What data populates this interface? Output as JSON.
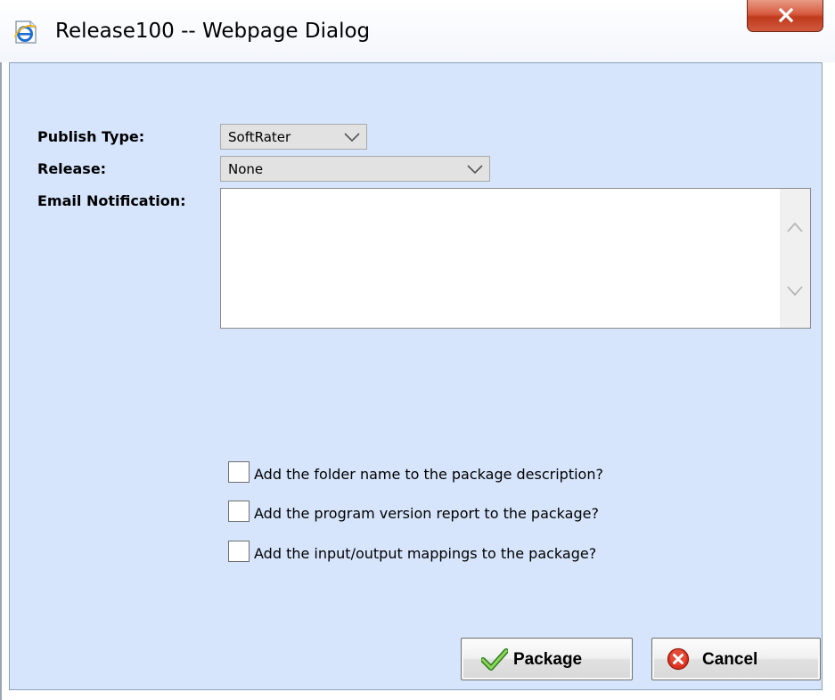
{
  "window": {
    "title": "Release100 -- Webpage Dialog",
    "close_icon": "close-x-icon",
    "app_icon": "internet-explorer-icon"
  },
  "form": {
    "publish_type": {
      "label": "Publish Type:",
      "value": "SoftRater"
    },
    "release": {
      "label": "Release:",
      "value": "None"
    },
    "email_notification": {
      "label": "Email Notification:",
      "value": ""
    }
  },
  "options": [
    {
      "label": "Add the folder name to the package description?",
      "checked": false
    },
    {
      "label": "Add the program version report to the package?",
      "checked": false
    },
    {
      "label": "Add the input/output mappings to the package?",
      "checked": false
    }
  ],
  "buttons": {
    "package": {
      "label": "Package",
      "icon": "green-checkmark-icon"
    },
    "cancel": {
      "label": "Cancel",
      "icon": "red-x-circle-icon"
    }
  },
  "colors": {
    "dialog_background": "#d6e5fc",
    "close_button": "#c7432a"
  }
}
